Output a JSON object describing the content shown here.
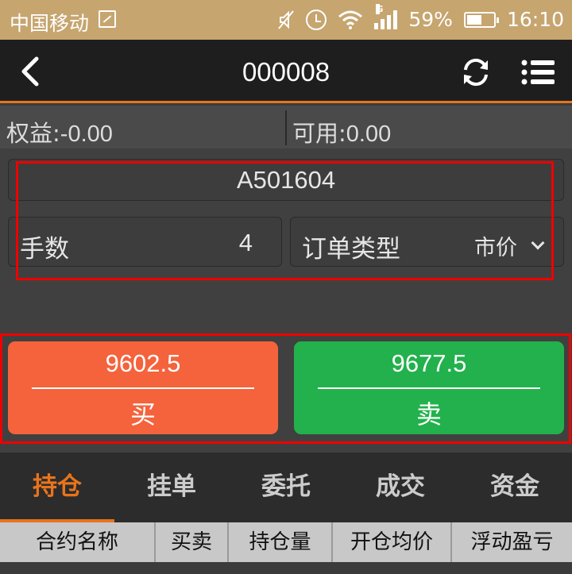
{
  "status_bar": {
    "carrier": "中国移动",
    "network_type": "G",
    "battery": "59%",
    "time": "16:10"
  },
  "header": {
    "title": "000008"
  },
  "account": {
    "equity_label": "权益:",
    "equity_value": "-0.00",
    "available_label": "可用:",
    "available_value": "0.00"
  },
  "order_form": {
    "contract": "A501604",
    "lots_label": "手数",
    "lots_value": "4",
    "order_type_label": "订单类型",
    "order_type_value": "市价"
  },
  "trade": {
    "buy_price": "9602.5",
    "buy_label": "买",
    "sell_price": "9677.5",
    "sell_label": "卖",
    "buy_color": "#f4633c",
    "sell_color": "#22b14c"
  },
  "tabs": [
    {
      "label": "持仓",
      "active": true
    },
    {
      "label": "挂单",
      "active": false
    },
    {
      "label": "委托",
      "active": false
    },
    {
      "label": "成交",
      "active": false
    },
    {
      "label": "资金",
      "active": false
    }
  ],
  "table": {
    "columns": [
      "合约名称",
      "买卖",
      "持仓量",
      "开仓均价",
      "浮动盈亏"
    ]
  },
  "colors": {
    "accent": "#e8741c",
    "status_bar": "#c6a56f",
    "highlight": "#ee0000"
  }
}
